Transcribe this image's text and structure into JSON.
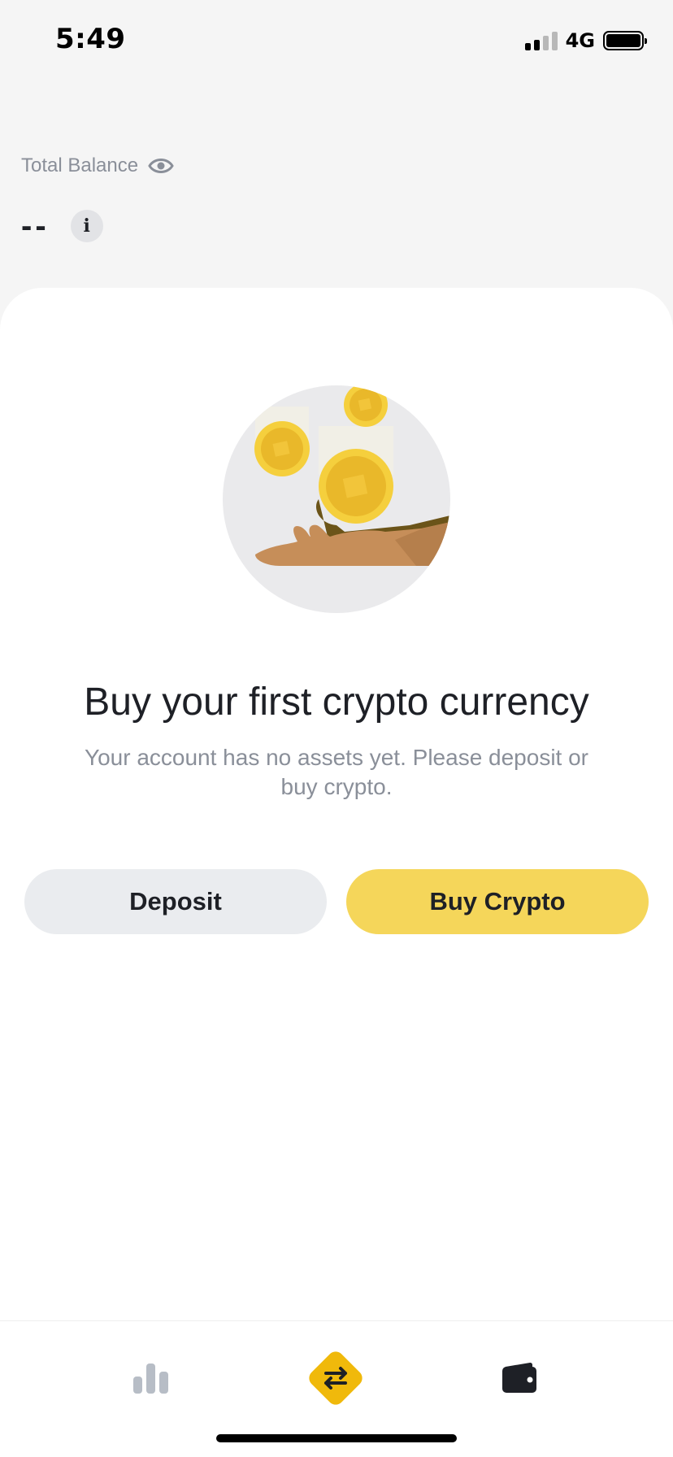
{
  "status_bar": {
    "time": "5:49",
    "network": "4G"
  },
  "balance": {
    "label": "Total Balance",
    "value": "--",
    "hidden_icon": "eye-icon",
    "info_icon": "info-icon"
  },
  "empty_state": {
    "title": "Buy your first crypto currency",
    "description": "Your account has no assets yet. Please deposit or buy crypto.",
    "illustration": "hand-with-coins-illustration"
  },
  "actions": {
    "deposit_label": "Deposit",
    "buy_label": "Buy Crypto"
  },
  "bottom_nav": {
    "items": [
      {
        "icon": "markets-chart-icon",
        "active": false
      },
      {
        "icon": "trade-swap-icon",
        "active": false
      },
      {
        "icon": "wallet-icon",
        "active": true
      }
    ]
  },
  "colors": {
    "accent": "#F0B90B",
    "button_primary": "#F5D65A",
    "button_secondary": "#EAECEF",
    "text_primary": "#1E2026",
    "text_secondary": "#8A8F99"
  }
}
